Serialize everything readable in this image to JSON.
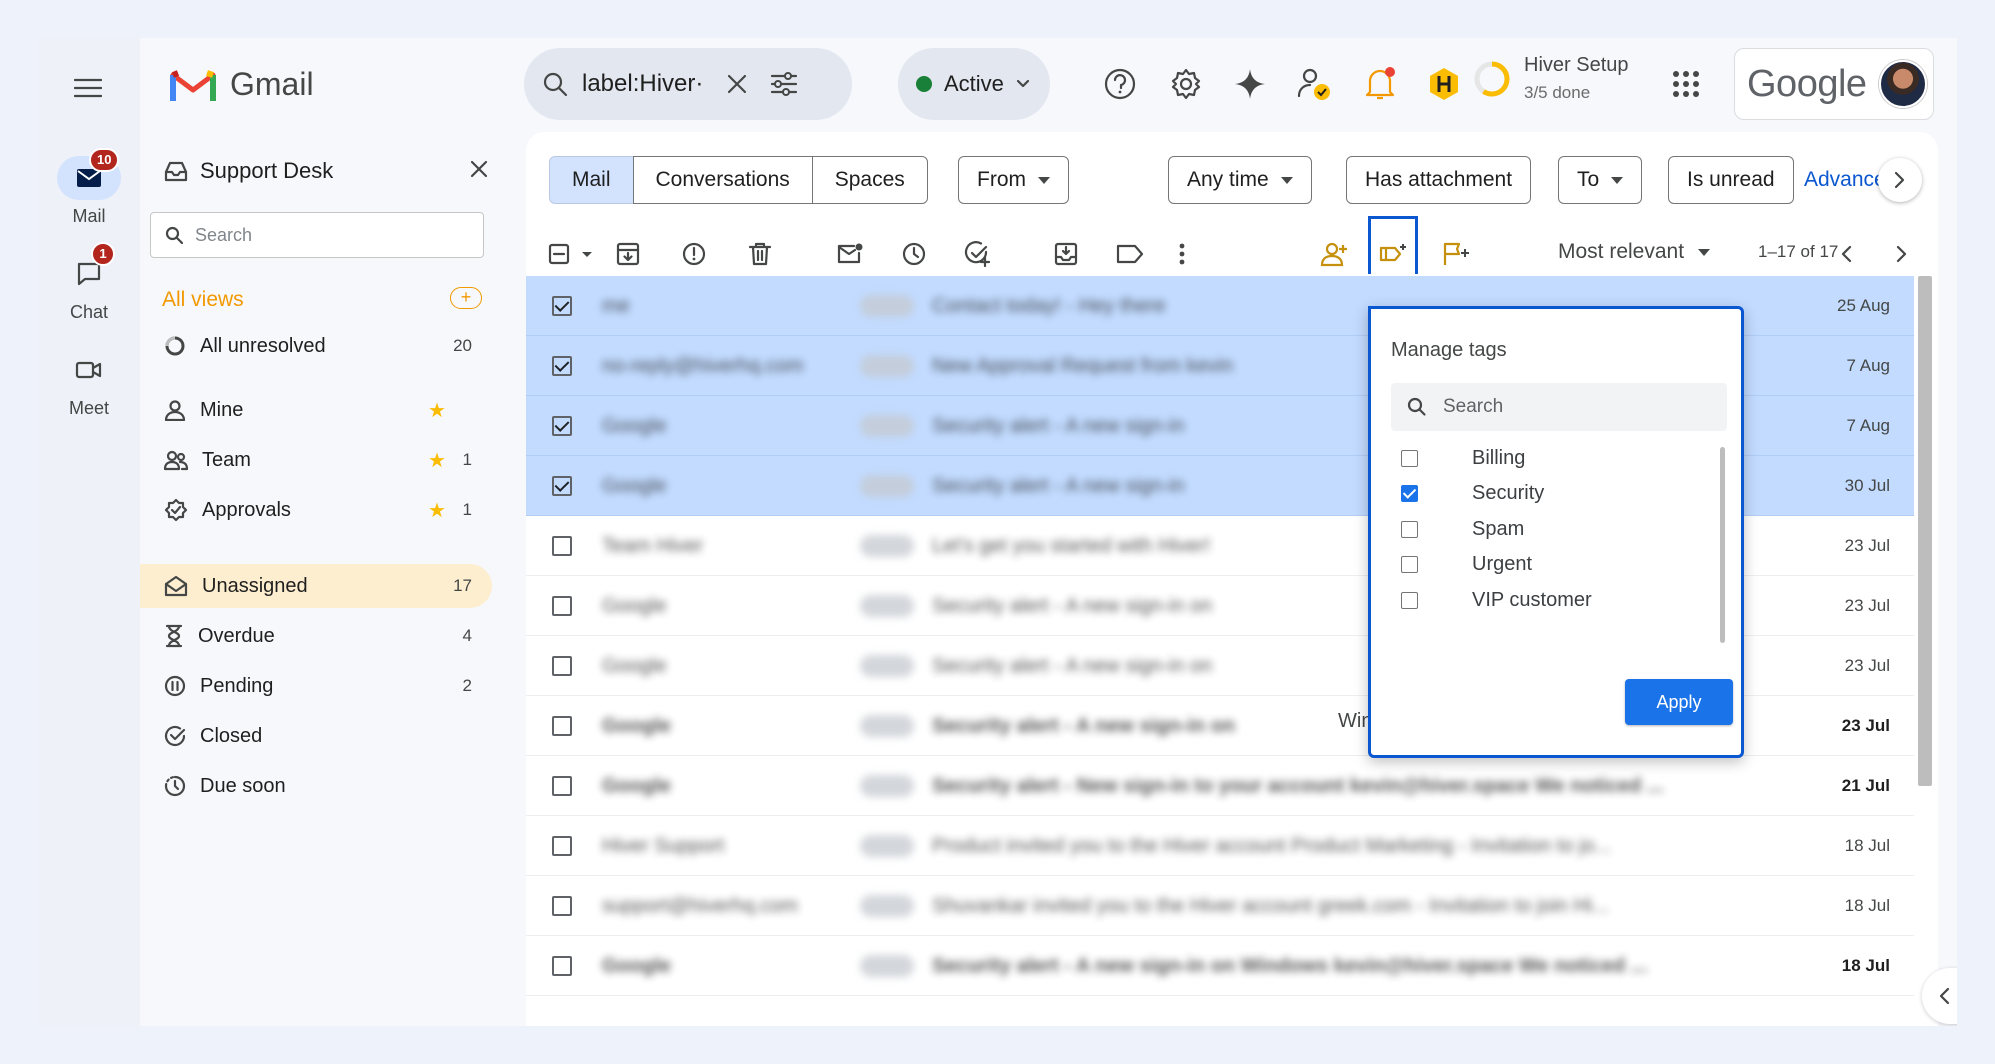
{
  "rail": {
    "items": [
      {
        "label": "Mail",
        "badge": "10"
      },
      {
        "label": "Chat",
        "badge": "1"
      },
      {
        "label": "Meet"
      }
    ]
  },
  "header": {
    "app_name": "Gmail",
    "search_query": "label:Hiver·",
    "status": "Active",
    "setup_title": "Hiver Setup",
    "setup_progress": "3/5 done",
    "brand": "Google"
  },
  "panel": {
    "title": "Support Desk",
    "search_placeholder": "Search",
    "views_title": "All views",
    "views_add": "+",
    "items": [
      {
        "label": "All unresolved",
        "count": "20"
      },
      {
        "label": "Mine",
        "count": "",
        "starred": true
      },
      {
        "label": "Team",
        "count": "1",
        "starred": true
      },
      {
        "label": "Approvals",
        "count": "1",
        "starred": true
      },
      {
        "label": "Unassigned",
        "count": "17"
      },
      {
        "label": "Overdue",
        "count": "4"
      },
      {
        "label": "Pending",
        "count": "2"
      },
      {
        "label": "Closed",
        "count": ""
      },
      {
        "label": "Due soon",
        "count": ""
      }
    ]
  },
  "main": {
    "segments": [
      "Mail",
      "Conversations",
      "Spaces"
    ],
    "filters": [
      "From",
      "Any time",
      "Has attachment",
      "To",
      "Is unread"
    ],
    "advanced": "Advance",
    "sort": "Most relevant",
    "range": "1–17 of 17",
    "rows": [
      {
        "sender": "me",
        "subject": "Contact today! - Hey there",
        "date": "25 Aug",
        "selected": true,
        "bold": false
      },
      {
        "sender": "no-reply@hiverhq.com",
        "subject": "New Approval Request from kevin",
        "date": "7 Aug",
        "selected": true,
        "bold": false
      },
      {
        "sender": "Google",
        "subject": "Security alert - A new sign-in",
        "date": "7 Aug",
        "selected": true,
        "bold": false
      },
      {
        "sender": "Google",
        "subject": "Security alert - A new sign-in",
        "date": "30 Jul",
        "selected": true,
        "bold": false
      },
      {
        "sender": "Team Hiver",
        "subject": "Let's get you started with Hiver!",
        "date": "23 Jul",
        "selected": false,
        "bold": false
      },
      {
        "sender": "Google",
        "subject": "Security alert - A new sign-in on",
        "date": "23 Jul",
        "selected": false,
        "bold": false
      },
      {
        "sender": "Google",
        "subject": "Security alert - A new sign-in on",
        "date": "23 Jul",
        "selected": false,
        "bold": false
      },
      {
        "sender": "Google",
        "subject": "Security alert - A new sign-in on",
        "date": "23 Jul",
        "selected": false,
        "bold": true,
        "snippet": "Windows kevin@hiver.space We noticed..."
      },
      {
        "sender": "Google",
        "subject": "Security alert - New sign-in to your account kevin@hiver.space We noticed ...",
        "date": "21 Jul",
        "selected": false,
        "bold": true
      },
      {
        "sender": "Hiver Support",
        "subject": "Product invited you to the Hiver account Product Marketing - Invitation to jo...",
        "date": "18 Jul",
        "selected": false,
        "bold": false
      },
      {
        "sender": "support@hiverhq.com",
        "subject": "Shuvankar invited you to the Hiver account greek.com - Invitation to join Hi...",
        "date": "18 Jul",
        "selected": false,
        "bold": false
      },
      {
        "sender": "Google",
        "subject": "Security alert - A new sign-in on Windows kevin@hiver.space We noticed ...",
        "date": "18 Jul",
        "selected": false,
        "bold": true
      }
    ]
  },
  "tags_popup": {
    "title": "Manage tags",
    "search_placeholder": "Search",
    "tags": [
      {
        "label": "Billing",
        "checked": false
      },
      {
        "label": "Security",
        "checked": true
      },
      {
        "label": "Spam",
        "checked": false
      },
      {
        "label": "Urgent",
        "checked": false
      },
      {
        "label": "VIP customer",
        "checked": false
      }
    ],
    "apply_label": "Apply"
  },
  "colors": {
    "accent": "#0b57d0",
    "selected_row": "#c2dbff",
    "views_orange": "#f29900",
    "badge_red": "#b3261e",
    "apply_blue": "#1a73e8"
  }
}
